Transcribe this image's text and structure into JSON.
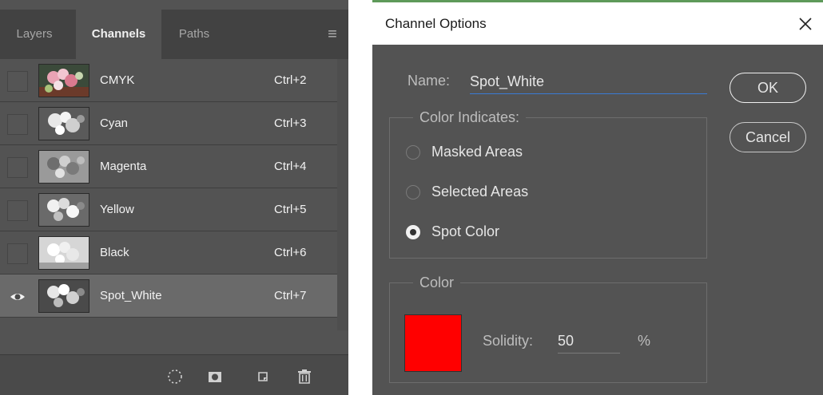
{
  "panel": {
    "tabs": [
      {
        "label": "Layers"
      },
      {
        "label": "Channels"
      },
      {
        "label": "Paths"
      }
    ],
    "menu_icon": "hamburger-menu-icon",
    "channels": [
      {
        "name": "CMYK",
        "shortcut": "Ctrl+2",
        "visible": false
      },
      {
        "name": "Cyan",
        "shortcut": "Ctrl+3",
        "visible": false
      },
      {
        "name": "Magenta",
        "shortcut": "Ctrl+4",
        "visible": false
      },
      {
        "name": "Yellow",
        "shortcut": "Ctrl+5",
        "visible": false
      },
      {
        "name": "Black",
        "shortcut": "Ctrl+6",
        "visible": false
      },
      {
        "name": "Spot_White",
        "shortcut": "Ctrl+7",
        "visible": true,
        "selected": true
      }
    ],
    "footer_icons": [
      "load-selection-icon",
      "save-selection-mask-icon",
      "new-channel-icon",
      "trash-icon"
    ]
  },
  "dialog": {
    "title": "Channel Options",
    "name_label": "Name:",
    "name_value": "Spot_White",
    "ok_label": "OK",
    "cancel_label": "Cancel",
    "color_indicates": {
      "legend": "Color Indicates:",
      "options": [
        {
          "label": "Masked Areas",
          "checked": false
        },
        {
          "label": "Selected Areas",
          "checked": false
        },
        {
          "label": "Spot Color",
          "checked": true
        }
      ]
    },
    "color_group": {
      "legend": "Color",
      "swatch_color": "#ff0000",
      "solidity_label": "Solidity:",
      "solidity_value": "50",
      "percent": "%"
    }
  }
}
